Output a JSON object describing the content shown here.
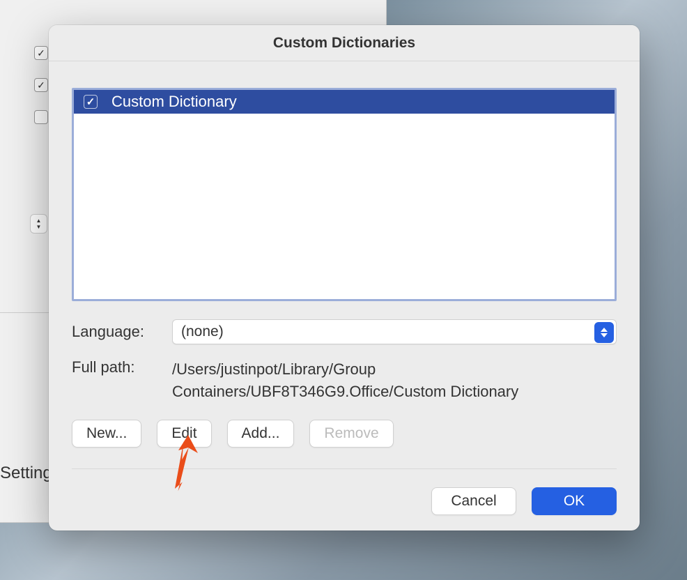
{
  "dialog": {
    "title": "Custom Dictionaries",
    "list": {
      "items": [
        {
          "label": "Custom Dictionary",
          "checked": true,
          "selected": true
        }
      ]
    },
    "language": {
      "label": "Language:",
      "value": "(none)"
    },
    "path": {
      "label": "Full path:",
      "value": "/Users/justinpot/Library/Group Containers/UBF8T346G9.Office/Custom Dictionary"
    },
    "buttons": {
      "new": "New...",
      "edit": "Edit",
      "add": "Add...",
      "remove": "Remove",
      "cancel": "Cancel",
      "ok": "OK"
    }
  },
  "underlying": {
    "settings": "Setting"
  }
}
